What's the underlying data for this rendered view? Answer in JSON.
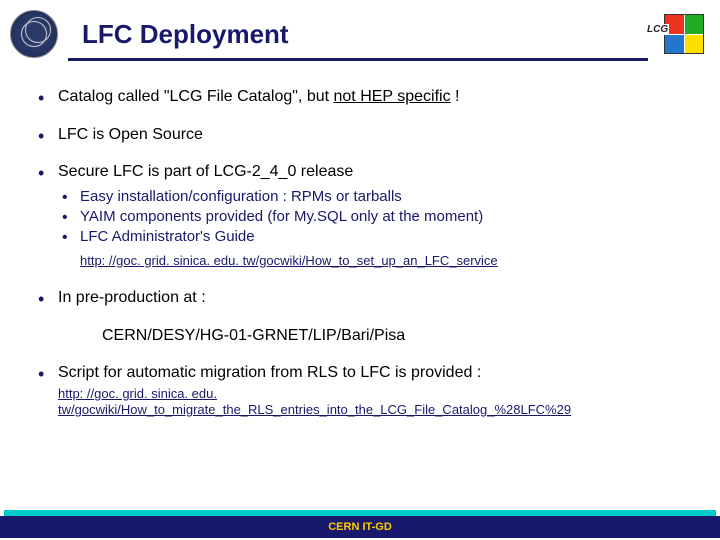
{
  "header": {
    "title": "LFC Deployment",
    "lcg_label": "LCG"
  },
  "bullets": {
    "b1_pre": "Catalog called \"LCG File Catalog\", but ",
    "b1_under": "not HEP specific",
    "b1_post": " !",
    "b2": "LFC is Open Source",
    "b3": "Secure LFC is part of LCG-2_4_0 release",
    "b3_sub1": "Easy installation/configuration : RPMs or tarballs",
    "b3_sub2": "YAIM components provided (for My.SQL only at the moment)",
    "b3_sub3": "LFC Administrator's Guide",
    "b3_link": "http: //goc. grid. sinica. edu. tw/gocwiki/How_to_set_up_an_LFC_service",
    "b4": "In pre-production at :",
    "b4_line2": "CERN/DESY/HG-01-GRNET/LIP/Bari/Pisa",
    "b5": "Script for automatic migration from RLS to LFC is provided :",
    "b5_link": "http: //goc. grid. sinica. edu. tw/gocwiki/How_to_migrate_the_RLS_entries_into_the_LCG_File_Catalog_%28LFC%29"
  },
  "footer": {
    "text": "CERN IT-GD"
  }
}
